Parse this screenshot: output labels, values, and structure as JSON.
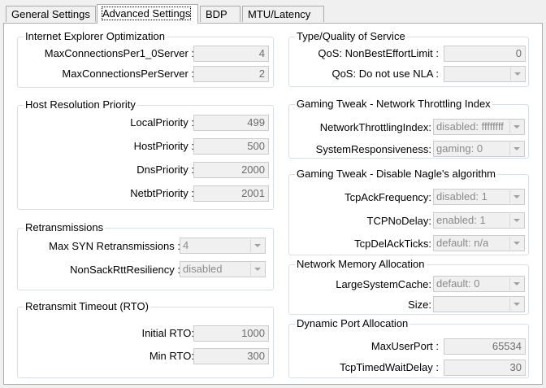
{
  "tabs": [
    "General Settings",
    "Advanced Settings",
    "BDP",
    "MTU/Latency"
  ],
  "groups": {
    "ie": {
      "title": "Internet Explorer Optimization",
      "rows": [
        {
          "label": "MaxConnectionsPer1_0Server :",
          "value": "4"
        },
        {
          "label": "MaxConnectionsPerServer :",
          "value": "2"
        }
      ]
    },
    "host": {
      "title": "Host Resolution Priority",
      "rows": [
        {
          "label": "LocalPriority :",
          "value": "499"
        },
        {
          "label": "HostPriority :",
          "value": "500"
        },
        {
          "label": "DnsPriority :",
          "value": "2000"
        },
        {
          "label": "NetbtPriority :",
          "value": "2001"
        }
      ]
    },
    "retrans": {
      "title": "Retransmissions",
      "rows": [
        {
          "label": "Max SYN Retransmissions :",
          "value": "4"
        },
        {
          "label": "NonSackRttResiliency :",
          "value": "disabled"
        }
      ]
    },
    "rto": {
      "title": "Retransmit Timeout (RTO)",
      "rows": [
        {
          "label": "Initial RTO:",
          "value": "1000"
        },
        {
          "label": "Min RTO:",
          "value": "300"
        }
      ]
    },
    "qos": {
      "title": "Type/Quality of Service",
      "rows": [
        {
          "label": "QoS: NonBestEffortLimit :",
          "value": "0"
        },
        {
          "label": "QoS: Do not use NLA :",
          "value": ""
        }
      ]
    },
    "throttle": {
      "title": "Gaming Tweak - Network Throttling Index",
      "rows": [
        {
          "label": "NetworkThrottlingIndex:",
          "value": "disabled: ffffffff"
        },
        {
          "label": "SystemResponsiveness:",
          "value": "gaming: 0"
        }
      ]
    },
    "nagle": {
      "title": "Gaming Tweak - Disable Nagle's algorithm",
      "rows": [
        {
          "label": "TcpAckFrequency:",
          "value": "disabled: 1"
        },
        {
          "label": "TCPNoDelay:",
          "value": "enabled: 1"
        },
        {
          "label": "TcpDelAckTicks:",
          "value": "default: n/a"
        }
      ]
    },
    "memory": {
      "title": "Network Memory Allocation",
      "rows": [
        {
          "label": "LargeSystemCache:",
          "value": "default: 0"
        },
        {
          "label": "Size:",
          "value": ""
        }
      ]
    },
    "port": {
      "title": "Dynamic Port Allocation",
      "rows": [
        {
          "label": "MaxUserPort :",
          "value": "65534"
        },
        {
          "label": "TcpTimedWaitDelay :",
          "value": "30"
        }
      ]
    }
  }
}
